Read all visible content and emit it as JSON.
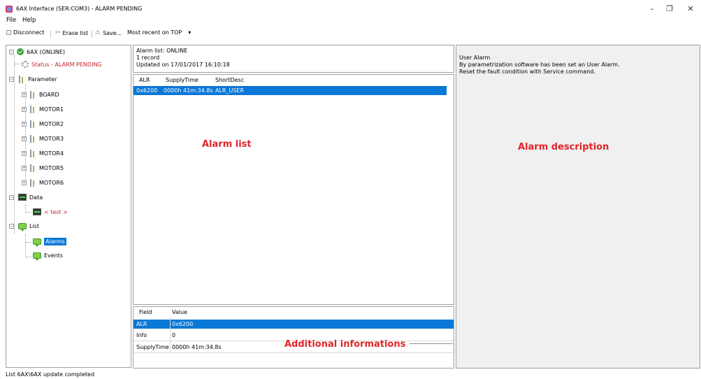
{
  "window": {
    "title": "6AX Interface (SER:COM3) - ALARM PENDING",
    "controls": {
      "minimize": "–",
      "maximize": "❐",
      "close": "✕"
    }
  },
  "menu": {
    "file": "File",
    "help": "Help"
  },
  "toolbar": {
    "disconnect": "Disconnect",
    "erase": "Erase list",
    "save": "Save...",
    "order": "Most recent on TOP",
    "order_arrow": "▾"
  },
  "tree": {
    "root": "6AX (ONLINE)",
    "status": "Status - ALARM PENDING",
    "parameter": "Parameter",
    "params": [
      "BOARD",
      "MOTOR1",
      "MOTOR2",
      "MOTOR3",
      "MOTOR4",
      "MOTOR5",
      "MOTOR6"
    ],
    "data": "Data",
    "data_child": "< test >",
    "list": "List",
    "alarms": "Alarms",
    "events": "Events"
  },
  "alarm_header": {
    "line1": "Alarm list: ONLINE",
    "line2": "1 record",
    "line3": "Updated on 17/01/2017 16:10:18"
  },
  "alarm_list": {
    "columns": [
      "ALR",
      "SupplyTime",
      "ShortDesc"
    ],
    "rows": [
      {
        "alr": "0x6200",
        "supply": "0000h 41m:34.8s",
        "short": "ALR_USER"
      }
    ]
  },
  "details": {
    "columns": [
      "Field",
      "Value"
    ],
    "rows": [
      {
        "field": "ALR",
        "value": "0x6200"
      },
      {
        "field": "Info",
        "value": "0"
      },
      {
        "field": "SupplyTime",
        "value": "0000h 41m:34.8s"
      }
    ]
  },
  "description": {
    "line1": "User Alarm",
    "line2": "By parametrization software has been set an User Alarm.",
    "line3": "Reset the fault condition with Service command."
  },
  "annotations": {
    "alarm_list": "Alarm list",
    "alarm_description": "Alarm description",
    "additional": "Additional informations"
  },
  "statusbar": {
    "text": "List 6AX\\6AX update completed"
  },
  "colors": {
    "selection": "#0a78d7",
    "annotation": "#e0262a",
    "status_red": "#c0272d"
  }
}
